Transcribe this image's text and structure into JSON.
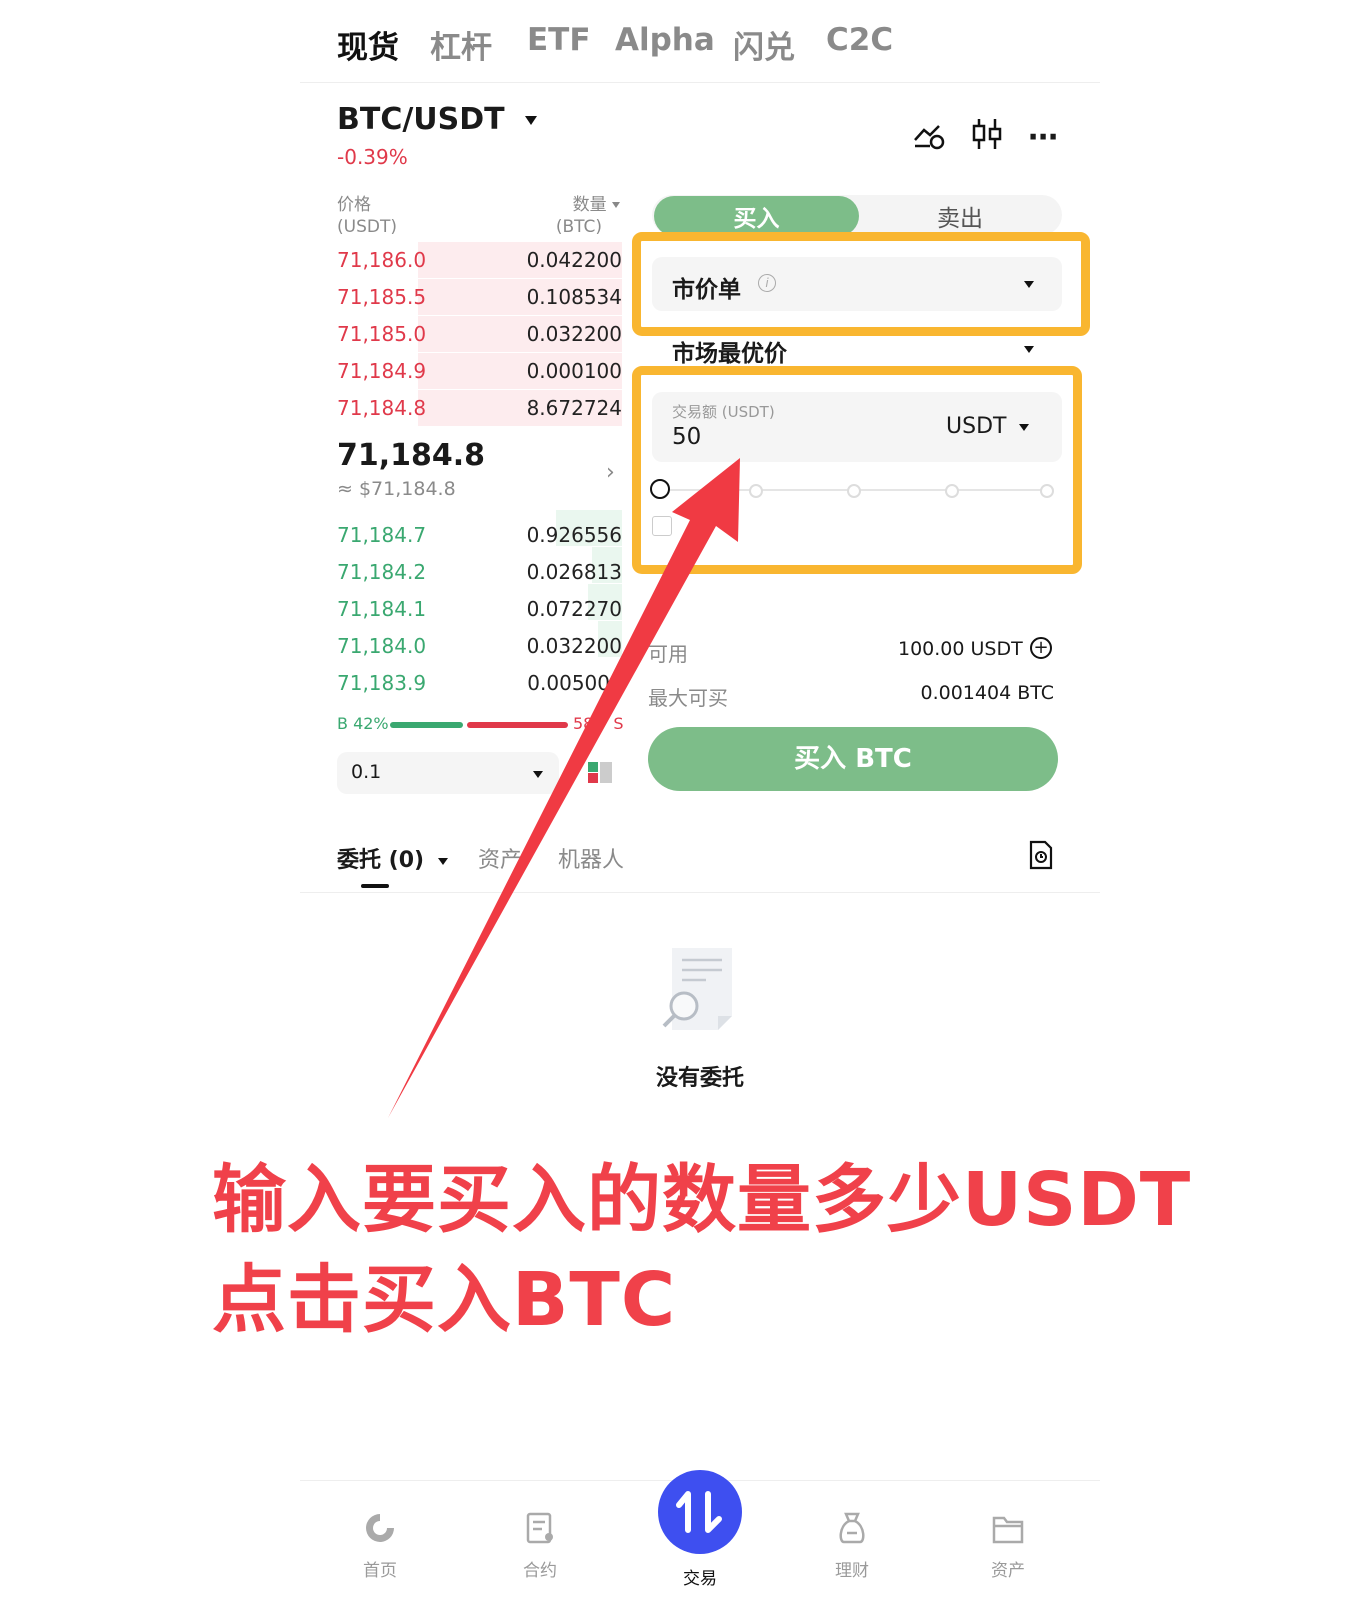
{
  "top_tabs": [
    "现货",
    "杠杆",
    "ETF",
    "Alpha",
    "闪兑",
    "C2C"
  ],
  "pair": {
    "symbol": "BTC/USDT",
    "change": "-0.39%"
  },
  "header_icons": [
    "price-alert-icon",
    "candlestick-chart-icon",
    "more-icon"
  ],
  "orderbook": {
    "price_header": "价格",
    "price_unit": "(USDT)",
    "qty_header": "数量",
    "qty_unit": "(BTC)",
    "asks": [
      {
        "price": "71,186.0",
        "qty": "0.042200"
      },
      {
        "price": "71,185.5",
        "qty": "0.108534"
      },
      {
        "price": "71,185.0",
        "qty": "0.032200"
      },
      {
        "price": "71,184.9",
        "qty": "0.000100"
      },
      {
        "price": "71,184.8",
        "qty": "8.672724"
      }
    ],
    "last_price": "71,184.8",
    "last_price_usd": "≈ $71,184.8",
    "bids": [
      {
        "price": "71,184.7",
        "qty": "0.926556"
      },
      {
        "price": "71,184.2",
        "qty": "0.026813"
      },
      {
        "price": "71,184.1",
        "qty": "0.072270"
      },
      {
        "price": "71,184.0",
        "qty": "0.032200"
      },
      {
        "price": "71,183.9",
        "qty": "0.00500"
      }
    ],
    "buy_ratio_label": "B 42%",
    "sell_ratio_label": "58",
    "sell_ratio_suffix": "S",
    "buy_ratio": 0.42,
    "precision": "0.1"
  },
  "trade_form": {
    "buy_tab": "买入",
    "sell_tab": "卖出",
    "order_type": "市价单",
    "price_type": "市场最优价",
    "amount_label": "交易额 (USDT)",
    "amount_value": "50",
    "amount_unit": "USDT",
    "available_label": "可用",
    "available_value": "100.00 USDT",
    "max_buy_label": "最大可买",
    "max_buy_value": "0.001404 BTC",
    "submit_label": "买入 BTC",
    "colors": {
      "buy": "#7dbd89",
      "sell_tab_bg": "#f4f4f4",
      "highlight": "#f9b630"
    }
  },
  "bottom_tabs": {
    "orders_label": "委托 (0)",
    "assets_label": "资产",
    "bots_label": "机器人"
  },
  "empty_state": "没有委托",
  "annotation": {
    "line1": "输入要买入的数量多少USDT",
    "line2": "点击买入BTC",
    "color": "#f0414a"
  },
  "nav": [
    {
      "label": "首页",
      "icon": "home-icon"
    },
    {
      "label": "合约",
      "icon": "futures-icon"
    },
    {
      "label": "交易",
      "icon": "trade-icon"
    },
    {
      "label": "理财",
      "icon": "earn-icon"
    },
    {
      "label": "资产",
      "icon": "wallet-icon"
    }
  ]
}
